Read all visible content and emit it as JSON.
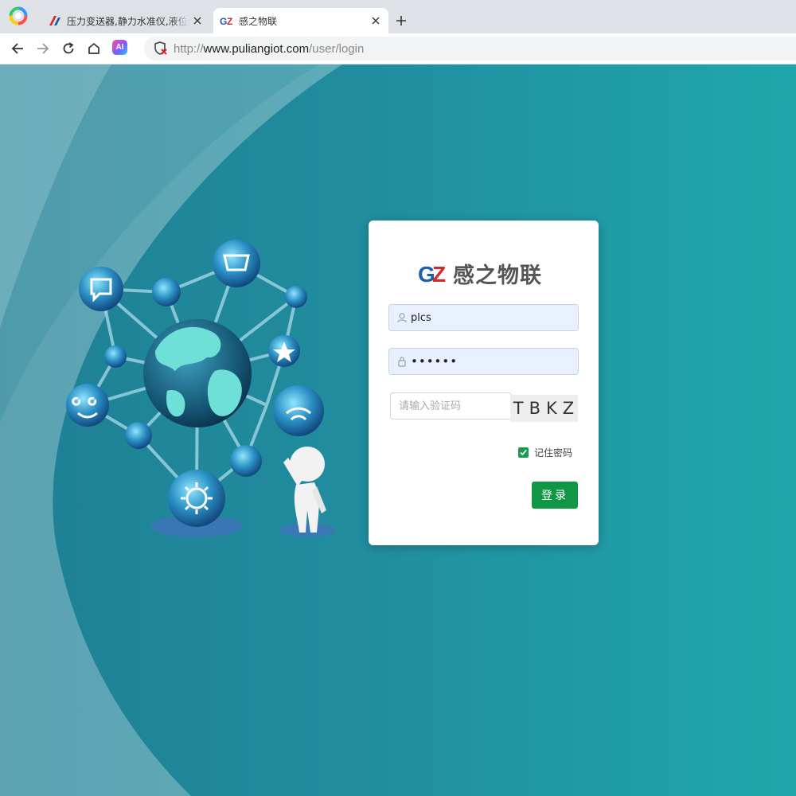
{
  "browser": {
    "tabs": [
      {
        "title": "压力变送器,静力水准仪,液位传感器",
        "active": false
      },
      {
        "title": "感之物联",
        "active": true
      }
    ],
    "url": {
      "scheme": "http://",
      "host": "www.puliangiot.com",
      "path": "/user/login"
    },
    "ai_button_label": "AI"
  },
  "login": {
    "brand_logo_text": "GZ",
    "brand_name": "感之物联",
    "username_value": "plcs",
    "password_value": "••••••",
    "captcha_placeholder": "请输入验证码",
    "captcha_text": "TBKZ",
    "remember_label": "记住密码",
    "remember_checked": true,
    "submit_label": "登录"
  },
  "colors": {
    "page_gradient_start": "#1e7f94",
    "page_gradient_end": "#1fa6ab",
    "login_button": "#0f9745",
    "checkbox": "#1a9b4f",
    "brand_blue": "#1d5fa8",
    "brand_red": "#d22a2a"
  },
  "icons": {
    "browser": "browser-logo-icon",
    "tab_close": "close-icon",
    "new_tab": "plus-icon",
    "back": "arrow-left-icon",
    "forward": "arrow-right-icon",
    "reload": "reload-icon",
    "home": "home-icon",
    "security": "insecure-shield-icon",
    "username": "user-icon",
    "password": "lock-icon"
  }
}
